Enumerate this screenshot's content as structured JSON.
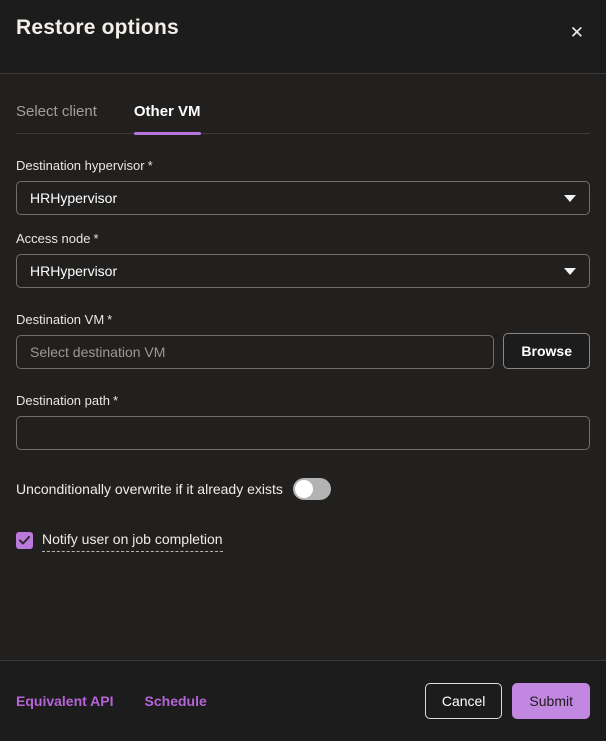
{
  "dialog": {
    "title": "Restore options",
    "close_icon": "✕"
  },
  "tabs": [
    {
      "label": "Select client",
      "active": false
    },
    {
      "label": "Other VM",
      "active": true
    }
  ],
  "fields": {
    "destination_hypervisor": {
      "label": "Destination hypervisor",
      "required": "*",
      "value": "HRHypervisor"
    },
    "access_node": {
      "label": "Access node",
      "required": "*",
      "value": "HRHypervisor"
    },
    "destination_vm": {
      "label": "Destination VM",
      "required": "*",
      "value": "",
      "placeholder": "Select destination VM",
      "browse_label": "Browse"
    },
    "destination_path": {
      "label": "Destination path",
      "required": "*",
      "value": ""
    }
  },
  "toggle": {
    "label": "Unconditionally overwrite if it already exists",
    "state": "off"
  },
  "checkbox": {
    "label": "Notify user on job completion",
    "checked": true
  },
  "footer": {
    "links": [
      {
        "label": "Equivalent API"
      },
      {
        "label": "Schedule"
      }
    ],
    "cancel_label": "Cancel",
    "submit_label": "Submit"
  },
  "colors": {
    "accent": "#b476d8",
    "checkbox": "#bb7adb",
    "link": "#b563d8",
    "submit": "#c287e0"
  }
}
